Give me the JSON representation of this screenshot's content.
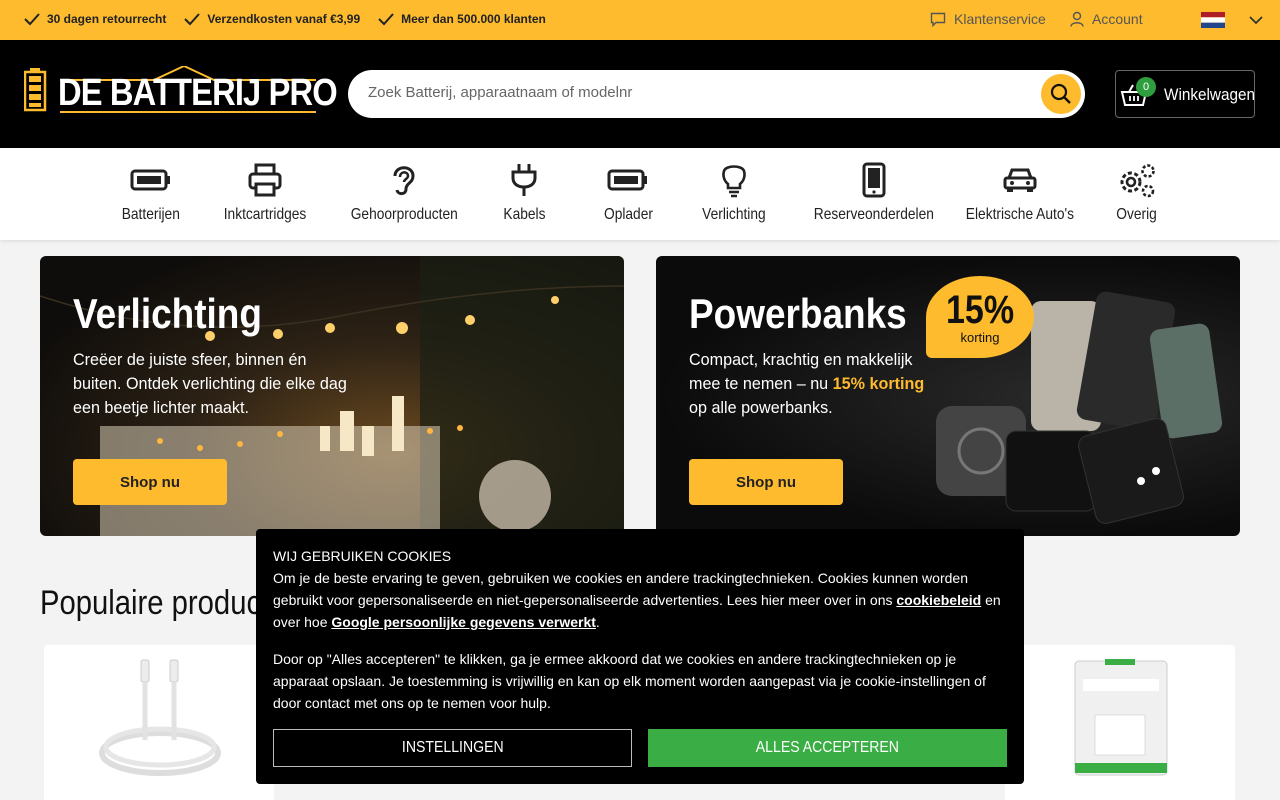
{
  "topbar": {
    "usps": [
      "30 dagen retourrecht",
      "Verzendkosten vanaf €3,99",
      "Meer dan 500.000 klanten"
    ],
    "customer_service": "Klantenservice",
    "account": "Account"
  },
  "header": {
    "logo_text": "DE BATTERIJ PRO",
    "search_placeholder": "Zoek Batterij, apparaatnaam of modelnr",
    "cart_count": "0",
    "cart_label": "Winkelwagen"
  },
  "categories": [
    {
      "label": "Batterijen",
      "icon": "battery-icon"
    },
    {
      "label": "Inktcartridges",
      "icon": "printer-icon"
    },
    {
      "label": "Gehoorproducten",
      "icon": "ear-icon"
    },
    {
      "label": "Kabels",
      "icon": "plug-icon"
    },
    {
      "label": "Oplader",
      "icon": "battery-icon"
    },
    {
      "label": "Verlichting",
      "icon": "lightbulb-icon"
    },
    {
      "label": "Reserveonderdelen",
      "icon": "phone-icon"
    },
    {
      "label": "Elektrische Auto's",
      "icon": "car-icon"
    },
    {
      "label": "Overig",
      "icon": "gears-icon"
    }
  ],
  "banners": [
    {
      "title": "Verlichting",
      "text": "Creëer de juiste sfeer, binnen én buiten. Ontdek verlichting die elke dag een beetje lichter maakt.",
      "button": "Shop nu"
    },
    {
      "title": "Powerbanks",
      "text_before": "Compact, krachtig en makkelijk mee te nemen – nu ",
      "text_highlight": "15% korting",
      "text_after": " op alle powerbanks.",
      "badge_big": "15%",
      "badge_small": "korting",
      "button": "Shop nu"
    }
  ],
  "popular": {
    "title": "Populaire producten"
  },
  "cookie": {
    "title": "WIJ GEBRUIKEN COOKIES",
    "p1_text": "Om je de beste ervaring te geven, gebruiken we cookies en andere trackingtechnieken. Cookies kunnen worden gebruikt voor gepersonaliseerde en niet-gepersonaliseerde advertenties. Lees hier meer over in ons ",
    "p1_link1": "cookiebeleid",
    "p1_mid": " en over hoe ",
    "p1_link2": "Google persoonlijke gegevens verwerkt",
    "p1_end": ".",
    "p2": "Door op \"Alles accepteren\" te klikken, ga je ermee akkoord dat we cookies en andere trackingtechnieken op je apparaat opslaan. Je toestemming is vrijwillig en kan op elk moment worden aangepast via je cookie-instellingen of door contact met ons op te nemen voor hulp.",
    "settings_button": "INSTELLINGEN",
    "accept_button": "ALLES ACCEPTEREN"
  },
  "colors": {
    "brand_yellow": "#fdbb2d",
    "header_black": "#000000",
    "accept_green": "#3aae44",
    "cart_badge_green": "#2e9e3e"
  }
}
